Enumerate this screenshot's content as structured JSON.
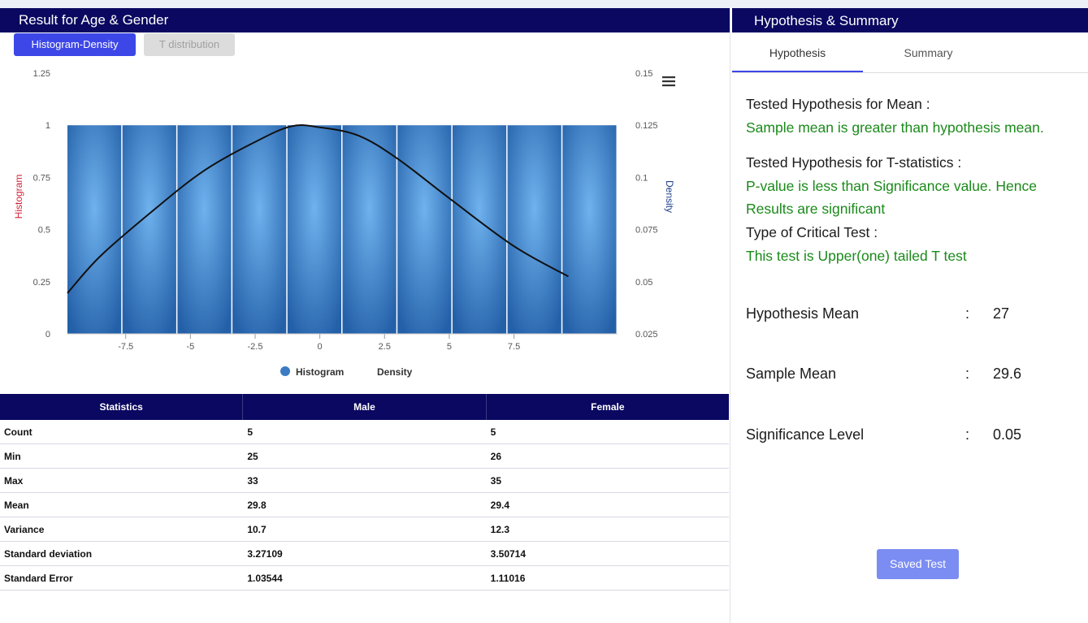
{
  "left_panel": {
    "title": "Result for  Age    & Gender",
    "tab_histogram": "Histogram-Density",
    "tab_t": "T distribution"
  },
  "chart_data": {
    "type": "bar",
    "x": [
      -9.25,
      -6.75,
      -4.25,
      -1.75,
      0.75,
      3.25,
      5.75,
      8.25
    ],
    "x_ticks": [
      "-7.5",
      "-5",
      "-2.5",
      "0",
      "2.5",
      "5",
      "7.5"
    ],
    "x_tick_values": [
      -7.5,
      -5,
      -2.5,
      0,
      2.5,
      5,
      7.5
    ],
    "xlim": [
      -9.75,
      11.5
    ],
    "left_axis": {
      "label": "Histogram",
      "ticks": [
        "0",
        "0.25",
        "0.5",
        "0.75",
        "1",
        "1.25"
      ],
      "ylim": [
        0,
        1.25
      ]
    },
    "right_axis": {
      "label": "Density",
      "ticks": [
        "0.025",
        "0.05",
        "0.075",
        "0.1",
        "0.125",
        "0.15"
      ],
      "ylim": [
        0.025,
        0.15
      ]
    },
    "series": [
      {
        "name": "Histogram",
        "values": [
          1,
          1,
          1,
          1,
          1,
          1,
          1,
          1,
          1,
          1
        ],
        "color": "#2a6fb8"
      },
      {
        "name": "Density",
        "points": [
          [
            -9.75,
            0.0445
          ],
          [
            -8.5,
            0.062
          ],
          [
            -6.5,
            0.0835
          ],
          [
            -4.5,
            0.103
          ],
          [
            -2.5,
            0.117
          ],
          [
            -1.1,
            0.1245
          ],
          [
            0,
            0.124
          ],
          [
            1.5,
            0.12
          ],
          [
            3,
            0.109
          ],
          [
            5,
            0.09
          ],
          [
            7.5,
            0.067
          ],
          [
            9.6,
            0.0525
          ]
        ],
        "color": "#111111"
      }
    ],
    "legend": [
      "Histogram",
      "Density"
    ],
    "legend_position": "bottom"
  },
  "table": {
    "headers": [
      "Statistics",
      "Male",
      "Female"
    ],
    "rows": [
      [
        "Count",
        "5",
        "5"
      ],
      [
        "Min",
        "25",
        "26"
      ],
      [
        "Max",
        "33",
        "35"
      ],
      [
        "Mean",
        "29.8",
        "29.4"
      ],
      [
        "Variance",
        "10.7",
        "12.3"
      ],
      [
        "Standard deviation",
        "3.27109",
        "3.50714"
      ],
      [
        "Standard Error",
        "1.03544",
        "1.11016"
      ]
    ]
  },
  "right_panel": {
    "title": "Hypothesis & Summary",
    "tabs": [
      "Hypothesis",
      "Summary"
    ],
    "mean_title": "Tested Hypothesis for Mean :",
    "mean_value": "Sample mean is greater than hypothesis mean.",
    "t_title": "Tested Hypothesis for T-statistics :",
    "t_value_1": "P-value is less than Significance value. Hence",
    "t_value_2": "Results are significant",
    "crit_title": "Type of Critical Test :",
    "crit_value": "This test is Upper(one) tailed T test",
    "kv": [
      {
        "key": "Hypothesis Mean",
        "sep": ":",
        "value": "27"
      },
      {
        "key": "Sample Mean",
        "sep": ":",
        "value": "29.6"
      },
      {
        "key": "Significance Level",
        "sep": ":",
        "value": "0.05"
      }
    ],
    "saved_button": "Saved Test"
  },
  "colors": {
    "header_bg": "#0a0860",
    "accent": "#3d47e8",
    "green": "#1a8a1a"
  }
}
